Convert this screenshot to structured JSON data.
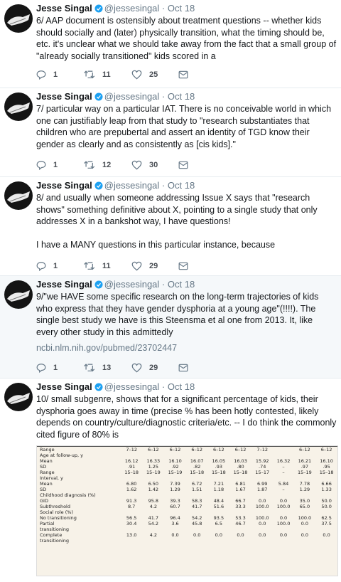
{
  "author": {
    "name": "Jesse Singal",
    "handle": "@jessesingal",
    "dot": "·"
  },
  "tweets": [
    {
      "date": "Oct 18",
      "text": "6/ AAP document is ostensibly about treatment questions -- whether kids should socially and (later) physically transition, what the timing should be, etc. it's unclear what we should take away from the fact that a small group of \"already socially transitioned\" kids scored in a",
      "replies": "1",
      "retweets": "11",
      "likes": "25"
    },
    {
      "date": "Oct 18",
      "text": "7/ particular way on a particular IAT. There is no conceivable world in which one can justifiably leap from that study to \"research substantiates that children who are prepubertal and assert an identity of TGD know their gender as clearly and as consistently as [cis kids].\"",
      "replies": "1",
      "retweets": "12",
      "likes": "30"
    },
    {
      "date": "Oct 18",
      "text": "8/ and usually when someone addressing Issue X says that \"research shows\" something definitive about X, pointing to a single study that only addresses X in a bankshot way, I have questions!\n\nI have a MANY questions in this particular instance, because",
      "replies": "1",
      "retweets": "11",
      "likes": "29"
    },
    {
      "date": "Oct 18",
      "text": "9/\"we HAVE some specific research on the long-term trajectories of kids who express that they have gender dysphoria at a young age\"(!!!!). The single best study we have is this Steensma et al one from 2013. It, like every other study in this admittedly",
      "link": "ncbi.nlm.nih.gov/pubmed/23702447",
      "replies": "1",
      "retweets": "13",
      "likes": "29"
    },
    {
      "date": "Oct 18",
      "text": "10/ small subgenre, shows that for a significant percentage of kids, their dysphoria goes away in time (precise % has been hotly contested, likely depends on country/culture/diagnostic criteria/etc. -- I do think the commonly cited figure of 80% is"
    }
  ],
  "table": {
    "rows": [
      {
        "label": "Range",
        "cells": [
          "7–12",
          "6–12",
          "6–12",
          "6–12",
          "6–12",
          "6–12",
          "7–12",
          "",
          "6–12",
          "6–12"
        ],
        "rule": true
      },
      {
        "label": "Age at follow-up, y",
        "cells": [
          "",
          "",
          "",
          "",
          "",
          "",
          "",
          "",
          "",
          ""
        ]
      },
      {
        "label": "Mean",
        "cells": [
          "16.12",
          "16.33",
          "16.10",
          "16.07",
          "16.05",
          "16.03",
          "15.92",
          "16.32",
          "16.21",
          "16.10"
        ]
      },
      {
        "label": "SD",
        "cells": [
          ".91",
          "1.25",
          ".92",
          ".82",
          ".93",
          ".80",
          ".74",
          "–",
          ".97",
          ".95"
        ]
      },
      {
        "label": "Range",
        "cells": [
          "15–18",
          "15–19",
          "15–19",
          "15–18",
          "15–18",
          "15–18",
          "15–17",
          "–",
          "15–19",
          "15–18"
        ]
      },
      {
        "label": "Interval, y",
        "cells": [
          "",
          "",
          "",
          "",
          "",
          "",
          "",
          "",
          "",
          ""
        ]
      },
      {
        "label": "Mean",
        "cells": [
          "6.80",
          "6.50",
          "7.39",
          "6.72",
          "7.21",
          "6.81",
          "6.99",
          "5.84",
          "7.78",
          "6.66"
        ]
      },
      {
        "label": "SD",
        "cells": [
          "1.62",
          "1.42",
          "1.29",
          "1.51",
          "1.18",
          "1.67",
          "1.87",
          "–",
          "1.29",
          "1.33"
        ]
      },
      {
        "label": "Childhood diagnosis (%)",
        "cells": [
          "",
          "",
          "",
          "",
          "",
          "",
          "",
          "",
          "",
          ""
        ]
      },
      {
        "label": "GID",
        "cells": [
          "91.3",
          "95.8",
          "39.3",
          "58.3",
          "48.4",
          "66.7",
          "0.0",
          "0.0",
          "35.0",
          "50.0"
        ]
      },
      {
        "label": "Subthreshold",
        "cells": [
          "8.7",
          "4.2",
          "60.7",
          "41.7",
          "51.6",
          "33.3",
          "100.0",
          "100.0",
          "65.0",
          "50.0"
        ]
      },
      {
        "label": "Social role (%)",
        "cells": [
          "",
          "",
          "",
          "",
          "",
          "",
          "",
          "",
          "",
          ""
        ]
      },
      {
        "label": "No transitioning",
        "cells": [
          "56.5",
          "41.7",
          "96.4",
          "54.2",
          "93.5",
          "53.3",
          "100.0",
          "0.0",
          "100.0",
          "62.5"
        ]
      },
      {
        "label": "Partial",
        "cells": [
          "30.4",
          "54.2",
          "3.6",
          "45.8",
          "6.5",
          "46.7",
          "0.0",
          "100.0",
          "0.0",
          "37.5"
        ]
      },
      {
        "label": "transitioning",
        "cells": [
          "",
          "",
          "",
          "",
          "",
          "",
          "",
          "",
          "",
          ""
        ]
      },
      {
        "label": "Complete",
        "cells": [
          "13.0",
          "4.2",
          "0.0",
          "0.0",
          "0.0",
          "0.0",
          "0.0",
          "0.0",
          "0.0",
          "0.0"
        ]
      },
      {
        "label": "transitioning",
        "cells": [
          "",
          "",
          "",
          "",
          "",
          "",
          "",
          "",
          "",
          ""
        ]
      }
    ]
  }
}
